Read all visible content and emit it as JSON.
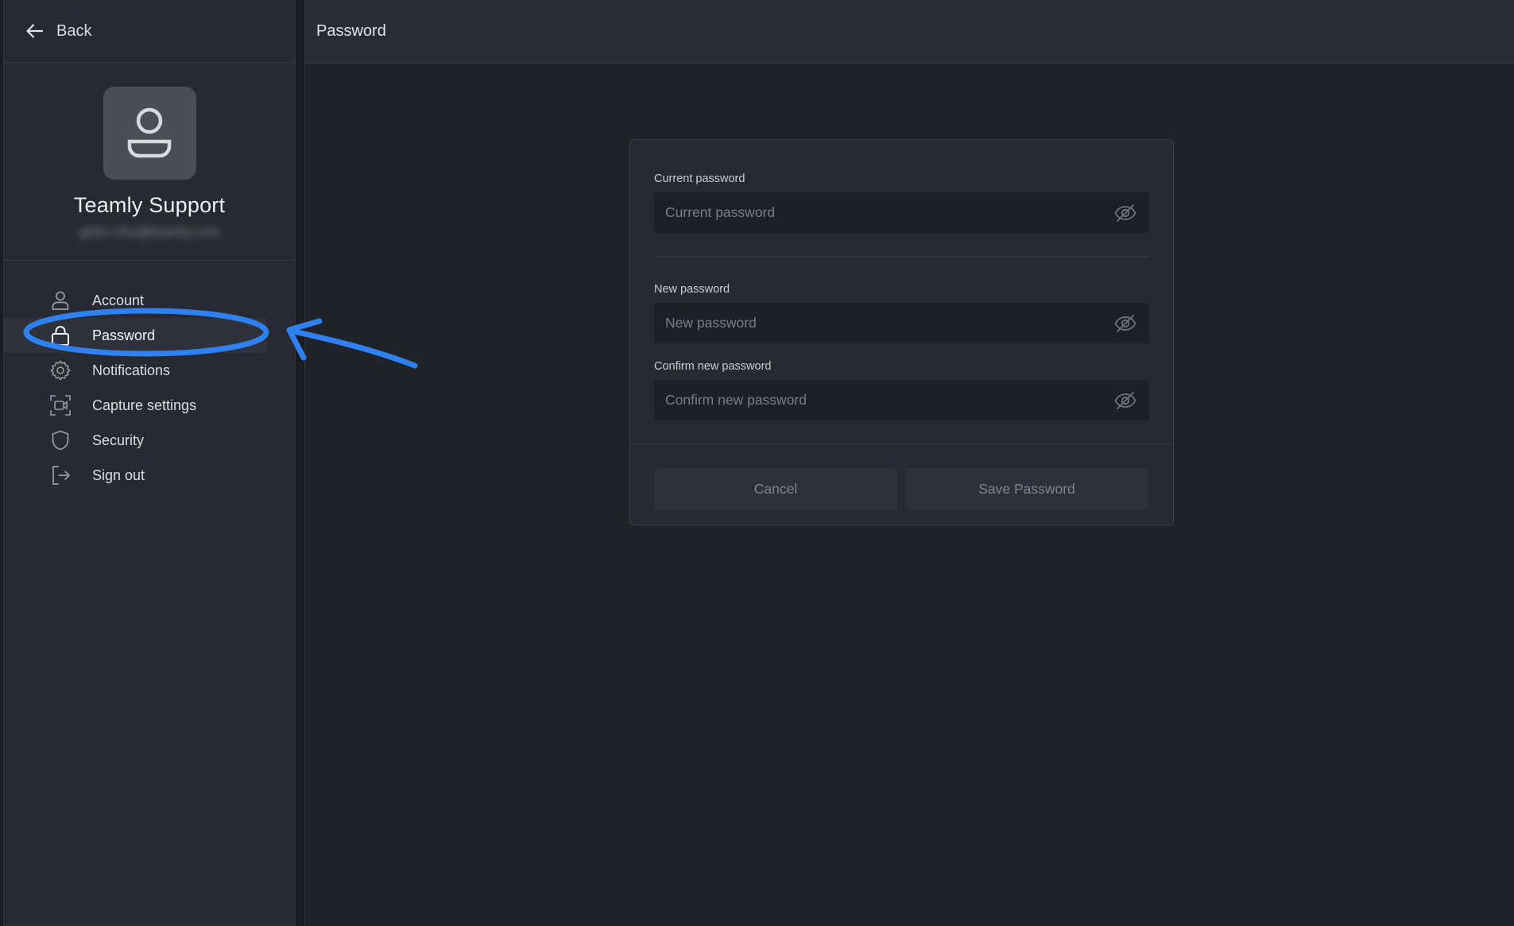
{
  "sidebar": {
    "back_label": "Back",
    "profile": {
      "name": "Teamly Support",
      "email": "gebu.cfsu@teamly.com"
    },
    "items": [
      {
        "label": "Account",
        "icon": "user-icon"
      },
      {
        "label": "Password",
        "icon": "lock-icon",
        "active": true
      },
      {
        "label": "Notifications",
        "icon": "gear-icon"
      },
      {
        "label": "Capture settings",
        "icon": "camera-icon"
      },
      {
        "label": "Security",
        "icon": "shield-icon"
      },
      {
        "label": "Sign out",
        "icon": "sign-out-icon"
      }
    ]
  },
  "main": {
    "title": "Password",
    "form": {
      "current_label": "Current password",
      "current_placeholder": "Current password",
      "new_label": "New password",
      "new_placeholder": "New password",
      "confirm_label": "Confirm new password",
      "confirm_placeholder": "Confirm new password",
      "cancel_label": "Cancel",
      "save_label": "Save Password"
    }
  },
  "colors": {
    "background": "#21232b",
    "sidebar": "#272a32",
    "annotation": "#2f80f0"
  }
}
